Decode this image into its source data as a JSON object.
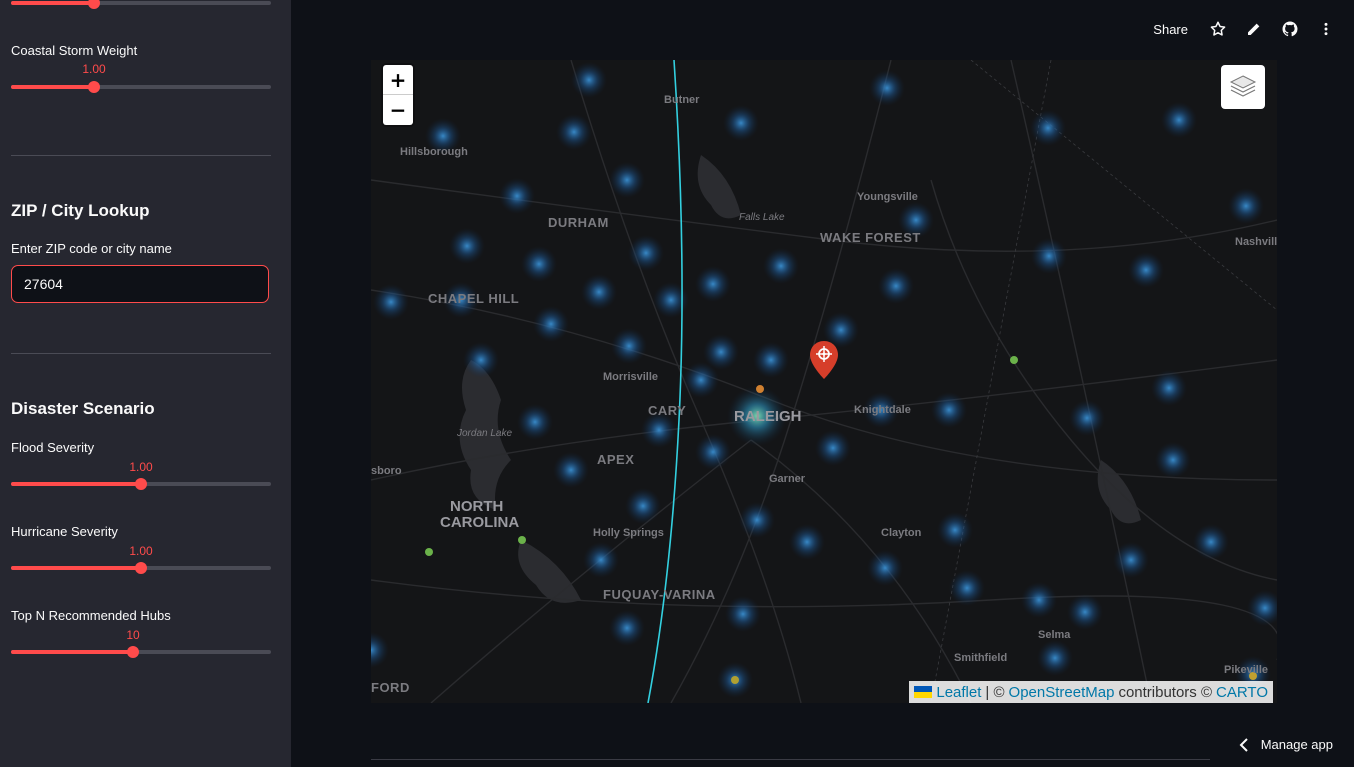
{
  "sidebar": {
    "top_slider": {
      "label": "",
      "value": 0.32
    },
    "coastal_storm": {
      "label": "Coastal Storm Weight",
      "value_text": "1.00",
      "value": 0.32
    },
    "lookup": {
      "title": "ZIP / City Lookup",
      "field_label": "Enter ZIP code or city name",
      "value": "27604"
    },
    "scenario": {
      "title": "Disaster Scenario",
      "flood": {
        "label": "Flood Severity",
        "value_text": "1.00",
        "value": 0.5
      },
      "hurricane": {
        "label": "Hurricane Severity",
        "value_text": "1.00",
        "value": 0.5
      },
      "top_n": {
        "label": "Top N Recommended Hubs",
        "value_text": "10",
        "value": 0.47
      }
    },
    "accent_color": "#ff4b4b"
  },
  "header": {
    "share": "Share",
    "icons": [
      "star-icon",
      "pencil-icon",
      "github-icon",
      "more-vert-icon"
    ]
  },
  "map": {
    "zoom_in": "+",
    "zoom_out": "−",
    "labels": {
      "butner": "Butner",
      "hillsborough": "Hillsborough",
      "durham": "DURHAM",
      "falls_lake": "Falls Lake",
      "youngsville": "Youngsville",
      "wake_forest": "WAKE FOREST",
      "nashville": "Nashville",
      "chapel_hill": "CHAPEL HILL",
      "morrisville": "Morrisville",
      "cary": "CARY",
      "raleigh": "RALEIGH",
      "knightdale": "Knightdale",
      "jordan_lake": "Jordan Lake",
      "apex": "APEX",
      "garner": "Garner",
      "sboro": "sboro",
      "north": "NORTH",
      "carolina": "CAROLINA",
      "holly_springs": "Holly Springs",
      "clayton": "Clayton",
      "fuquay": "FUQUAY-VARINA",
      "selma": "Selma",
      "smithfield": "Smithfield",
      "pikeville": "Pikeville",
      "ford": "FORD"
    },
    "attribution": {
      "leaflet": "Leaflet",
      "sep": "| ©",
      "osm": "OpenStreetMap",
      "contrib": "contributors ©",
      "carto": "CARTO"
    }
  },
  "footer": {
    "manage_app": "Manage app"
  }
}
